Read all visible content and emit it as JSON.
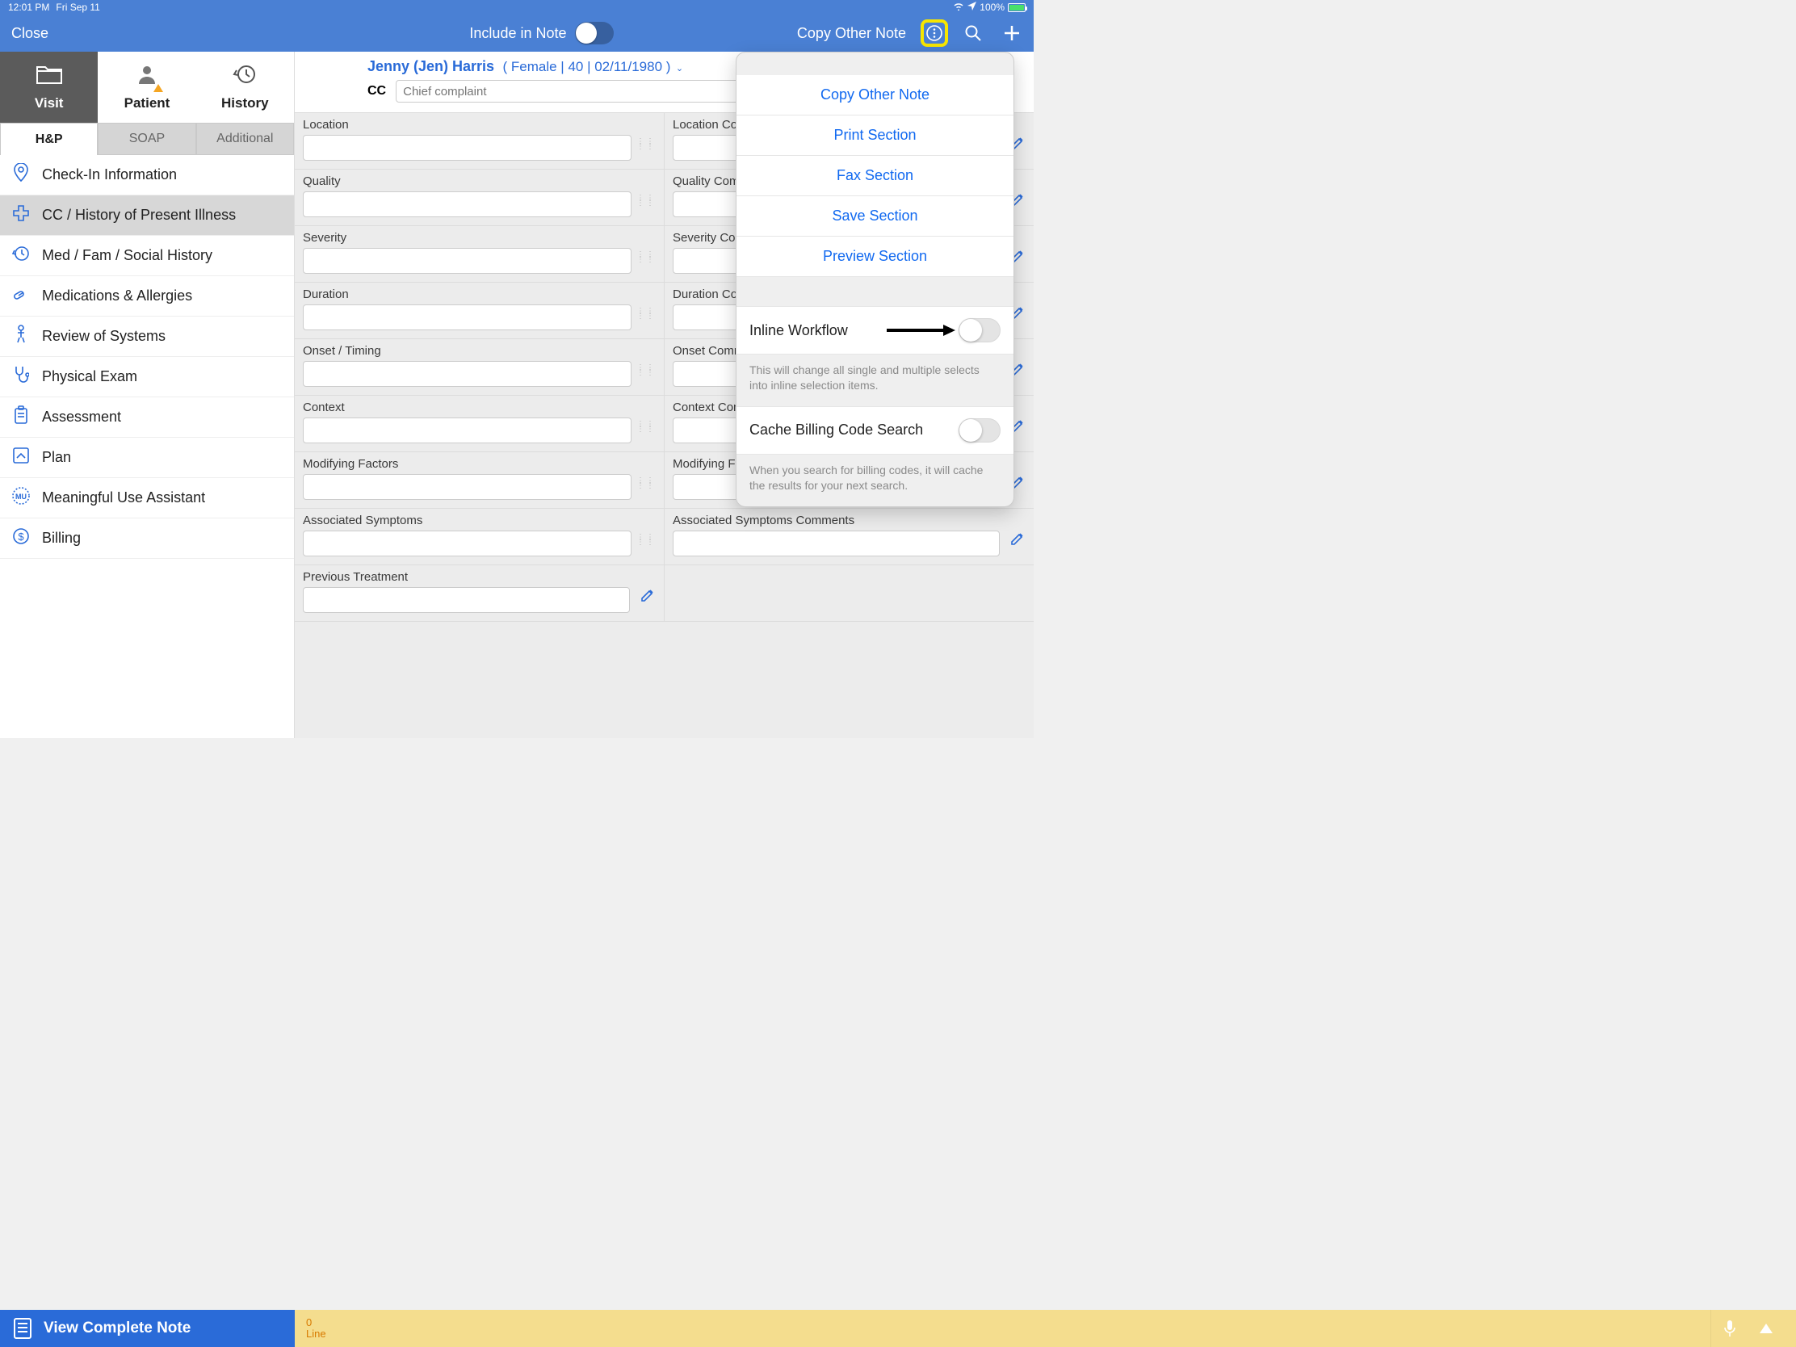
{
  "status": {
    "time": "12:01 PM",
    "date": "Fri Sep 11",
    "battery": "100%"
  },
  "topbar": {
    "close": "Close",
    "include_label": "Include in Note",
    "copy_other": "Copy Other Note"
  },
  "mode_tabs": {
    "visit": "Visit",
    "patient": "Patient",
    "history": "History"
  },
  "subtabs": {
    "hp": "H&P",
    "soap": "SOAP",
    "additional": "Additional"
  },
  "nav": [
    "Check-In Information",
    "CC / History of Present Illness",
    "Med / Fam / Social History",
    "Medications & Allergies",
    "Review of Systems",
    "Physical Exam",
    "Assessment",
    "Plan",
    "Meaningful Use Assistant",
    "Billing"
  ],
  "patient": {
    "name": "Jenny (Jen) Harris",
    "meta": "( Female | 40 | 02/11/1980 )",
    "cc_label": "CC",
    "cc_placeholder": "Chief complaint"
  },
  "fields": [
    {
      "l": "Location",
      "r": "Location Comments"
    },
    {
      "l": "Quality",
      "r": "Quality Comments"
    },
    {
      "l": "Severity",
      "r": "Severity Comments"
    },
    {
      "l": "Duration",
      "r": "Duration Comments"
    },
    {
      "l": "Onset / Timing",
      "r": "Onset Comments"
    },
    {
      "l": "Context",
      "r": "Context Comments"
    },
    {
      "l": "Modifying Factors",
      "r": "Modifying Factors Comments"
    },
    {
      "l": "Associated Symptoms",
      "r": "Associated Symptoms Comments"
    },
    {
      "l": "Previous Treatment",
      "r": ""
    }
  ],
  "footer": {
    "view_note": "View Complete Note",
    "count": "0",
    "line": "Line"
  },
  "popover": {
    "items": [
      "Copy Other Note",
      "Print Section",
      "Fax Section",
      "Save Section",
      "Preview Section"
    ],
    "inline_label": "Inline Workflow",
    "inline_desc": "This will change all single and multiple selects into inline selection items.",
    "cache_label": "Cache Billing Code Search",
    "cache_desc": "When you search for billing codes, it will cache the results for your next search."
  }
}
